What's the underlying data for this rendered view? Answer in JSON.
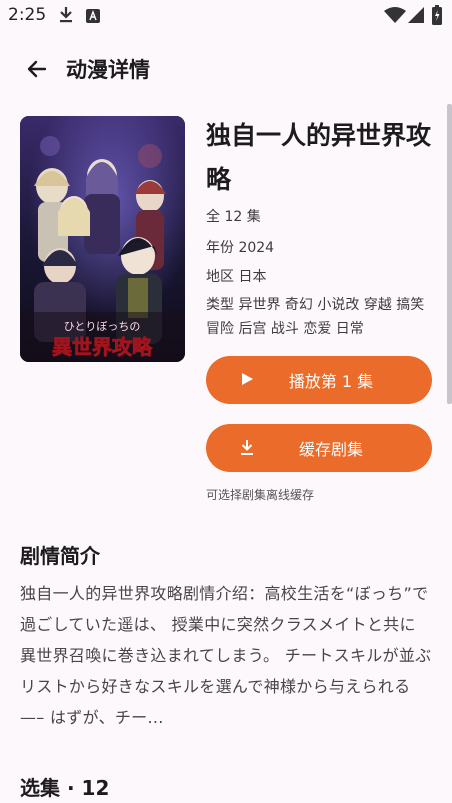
{
  "status_bar": {
    "time": "2:25"
  },
  "header": {
    "title": "动漫详情"
  },
  "anime": {
    "title": "独自一人的异世界攻略",
    "episodes": "全 12 集",
    "year": "年份  2024",
    "region": "地区  日本",
    "genres": "类型  异世界 奇幻 小说改 穿越 搞笑 冒险 后宫 战斗 恋爱 日常",
    "poster_logo": "ひとりぼっちの異世界攻略"
  },
  "actions": {
    "play_label": "播放第 1 集",
    "download_label": "缓存剧集",
    "download_hint": "可选择剧集离线缓存"
  },
  "synopsis": {
    "heading": "剧情简介",
    "text": "独自一人的异世界攻略剧情介绍：高校生活を“ぼっち”で過ごしていた遥は、 授業中に突然クラスメイトと共に異世界召喚に巻き込まれてしまう。 チートスキルが並ぶリストから好きなスキルを選んで神様から与えられる—– はずが、チー..."
  },
  "episodes_section": {
    "heading": "选集 · 12"
  },
  "colors": {
    "accent": "#ea6b2a",
    "background": "#fcf8fb"
  }
}
